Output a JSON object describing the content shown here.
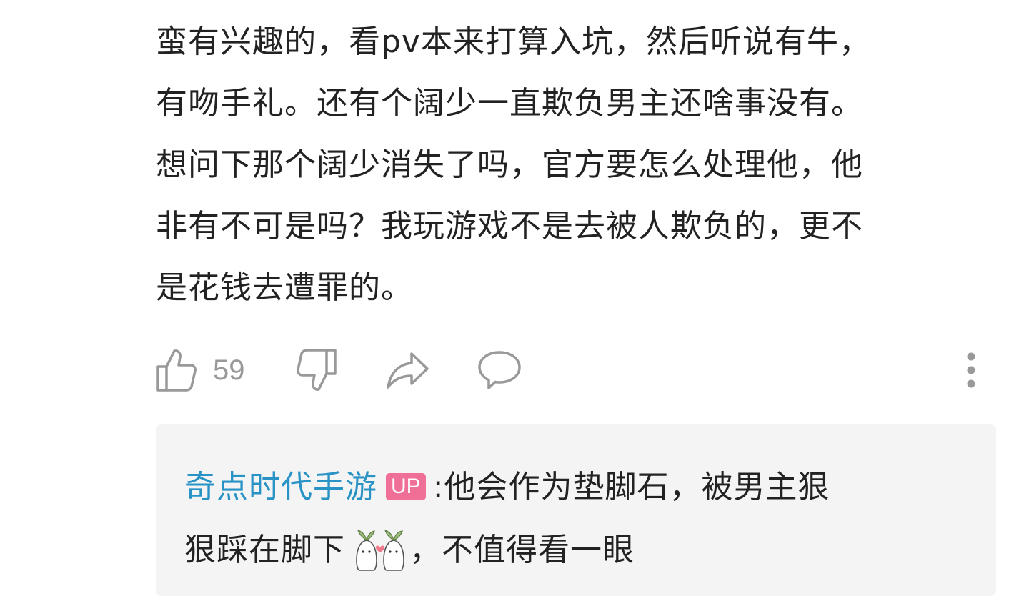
{
  "comment": {
    "lines": [
      "蛮有兴趣的，看pv本来打算入坑，然后听说有牛，",
      "有吻手礼。还有个阔少一直欺负男主还啥事没有。",
      "想问下那个阔少消失了吗，官方要怎么处理他，他",
      "非有不可是吗？我玩游戏不是去被人欺负的，更不",
      "是花钱去遭罪的。"
    ]
  },
  "actions": {
    "like_count": "59",
    "icons": [
      "thumbs-up-icon",
      "thumbs-down-icon",
      "share-icon",
      "comment-icon",
      "more-vertical-icon"
    ],
    "icon_color": "#999999"
  },
  "reply": {
    "author": "奇点时代手游",
    "badge": "UP",
    "colon": ":",
    "text_line1": "他会作为垫脚石，被男主狠",
    "text_line2_before_emoji": "狠踩在脚下",
    "emoji": "couple-emoji",
    "text_line2_after_emoji": "，不值得看一眼",
    "author_color": "#2a93c6",
    "badge_color": "#f06f97",
    "background": "#f4f4f4"
  }
}
